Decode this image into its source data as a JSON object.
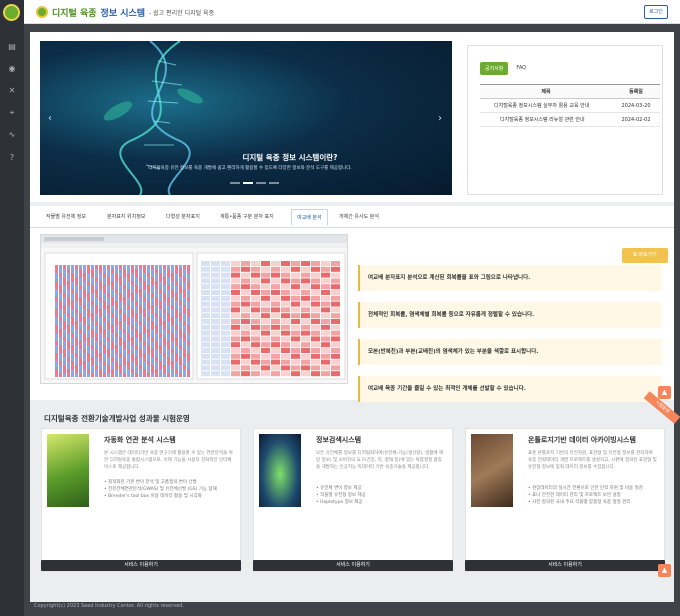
{
  "header": {
    "brand_part1": "디지털 육종",
    "brand_part2": "정보 시스템",
    "brand_tagline": "- 쉽고 편리한 디지털 육종",
    "login_label": "로그인"
  },
  "sidebar": {
    "icons": [
      "menu-icon",
      "document-icon",
      "database-icon",
      "dna-icon",
      "map-pin-icon",
      "analytics-icon",
      "help-icon"
    ]
  },
  "hero": {
    "title": "디지털 육종 정보 시스템이란?",
    "subtitle": "디지털육종 유전 정보를 육종 개발에 쉽고 편리하게 활용할 수 있도록 다양한 정보와 분석 도구를 제공합니다.",
    "prev_arrow": "‹",
    "next_arrow": "›"
  },
  "notice": {
    "tabs": [
      "공지사항",
      "FAQ"
    ],
    "columns": [
      "제목",
      "등록일"
    ],
    "rows": [
      {
        "title": "디지털육종 정보시스템 실무자 활용 교육 안내",
        "date": "2024-03-20"
      },
      {
        "title": "디지털육종 정보시스템 리뉴얼 관련 안내",
        "date": "2024-02-02"
      }
    ]
  },
  "feature_tabs": [
    "작물별 유전체 정보",
    "분자표지 위치정보",
    "다형성 분자표지",
    "계통•품종 구분 분자 표지",
    "여교배 분석",
    "개체간 유사도 분석"
  ],
  "feature": {
    "go_button": "바로가기",
    "descriptions": [
      "여교배 분자표지 분석으로 계산된 회복률을 표와 그림으로 나타냅니다.",
      "전체적인 회복률, 염색체별 회복률 등으로 자유롭게 정렬할 수 있습니다.",
      "모본(반복친)과 부본(교배친)의 염색체가 있는 부분을 색깔로 표시합니다.",
      "여교배 육종 기간을 줄일 수 있는 최적인 개체를 선발할 수 있습니다."
    ]
  },
  "projects": {
    "section_title": "디지털육종 전환기술개발사업 성과물 시험운영",
    "badge": "시험운영",
    "cards": [
      {
        "title": "자동화 연관 분석 시스템",
        "desc": "본 시스템은 데이터기반 육종 연구기에 활용할 수 있는 연관분석을 위한 디지털육종 통합시스템으로, 이제 기능을 사용자 친화적인 인터페이스로 제공합니다.",
        "bullets": [
          "최적화된 기본 변이 분석 및 고품질의 변이 선발",
          "전유전체연관분석(GWAS) 및 유전체선발 (GS) 기능 탑재",
          "Breeder's tool box 이용 데이터 활용 및 시각화"
        ],
        "button": "서비스 이용하기"
      },
      {
        "title": "정보검색시스템",
        "desc": "모든 유전체를 정보를 디지털화하여(유전체·기능(생산량), 생활에 해당 정보) 및 소비자의 요구(건강, 맛, 향태 등)에 맞는 복합형질 품종을 개발하는 인공지능 빅데이터 기반 육종기술을 제공합니다.",
        "bullets": [
          "유전체 변이 정보 제공",
          "작물별 유전형 정보 제공",
          "Haplotype 정보 제공"
        ],
        "button": "서비스 이용하기"
      },
      {
        "title": "온톨로지기반 데이터 아카이빙시스템",
        "desc": "표준 온톨로지 기반의 유전자원, 표현형 및 유전형 정보를 관리하여 육종 전략데이터 개발 프로젝트를 생성하고, 시판에 정의된 표현형 및 유전형 정보에 맞춰 데이터 정보를 수집합니다.",
        "bullets": [
          "현장데이터의 실시간 전환으로 인한 인적 자원 및 비용 절감",
          "표나 안전한 데이터 관리 및 프로젝트 보안 설정",
          "사전 정의된 국내 주요 작물별 맞춤형 육종 형질 관리"
        ],
        "button": "서비스 이용하기"
      }
    ]
  },
  "footer": {
    "copyright": "Copyright(c) 2023 Seed Industry Center. All rights reserved."
  }
}
